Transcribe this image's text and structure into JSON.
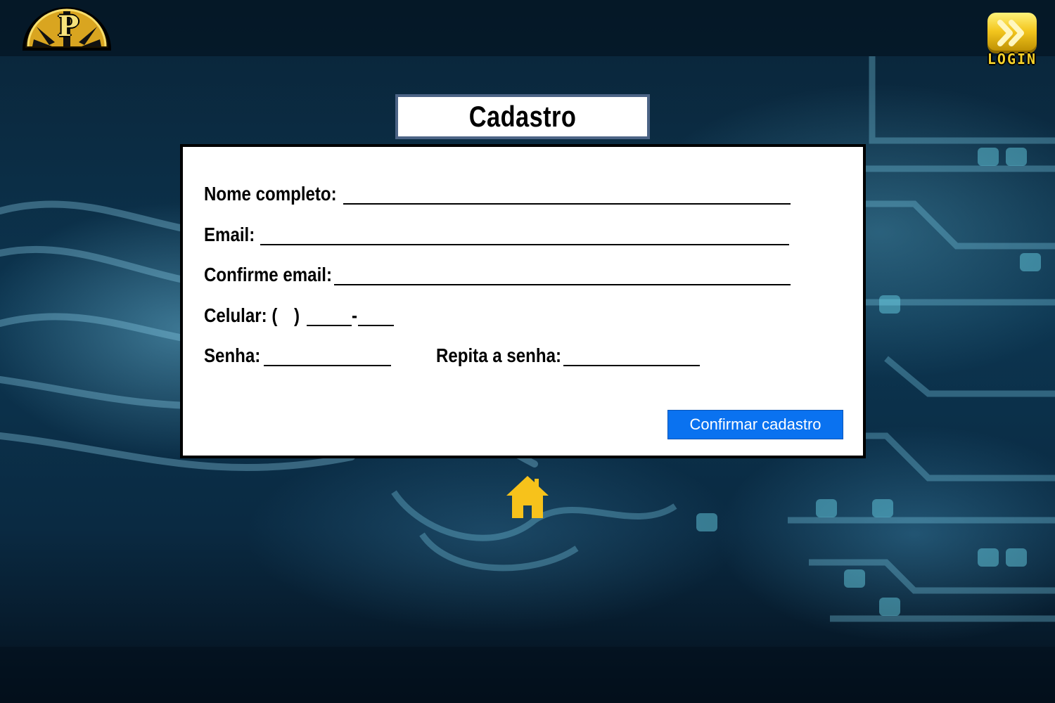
{
  "header": {
    "logo_text": "P",
    "login_label": "LOGIN"
  },
  "form": {
    "title": "Cadastro",
    "fields": {
      "nome_label": "Nome completo:",
      "email_label": "Email:",
      "confirm_email_label": "Confirme email:",
      "celular_label": "Celular: (",
      "celular_close": ")",
      "celular_dash": "-",
      "senha_label": "Senha:",
      "repita_senha_label": "Repita a senha:"
    },
    "submit_label": "Confirmar cadastro"
  },
  "colors": {
    "accent_button": "#0a72f0",
    "home_icon": "#f7c21b",
    "login_icon": "#f3c61e",
    "title_border": "#4c6486"
  },
  "icons": {
    "home": "home-icon",
    "login": "double-chevron-right-icon",
    "logo": "logo-icon"
  }
}
